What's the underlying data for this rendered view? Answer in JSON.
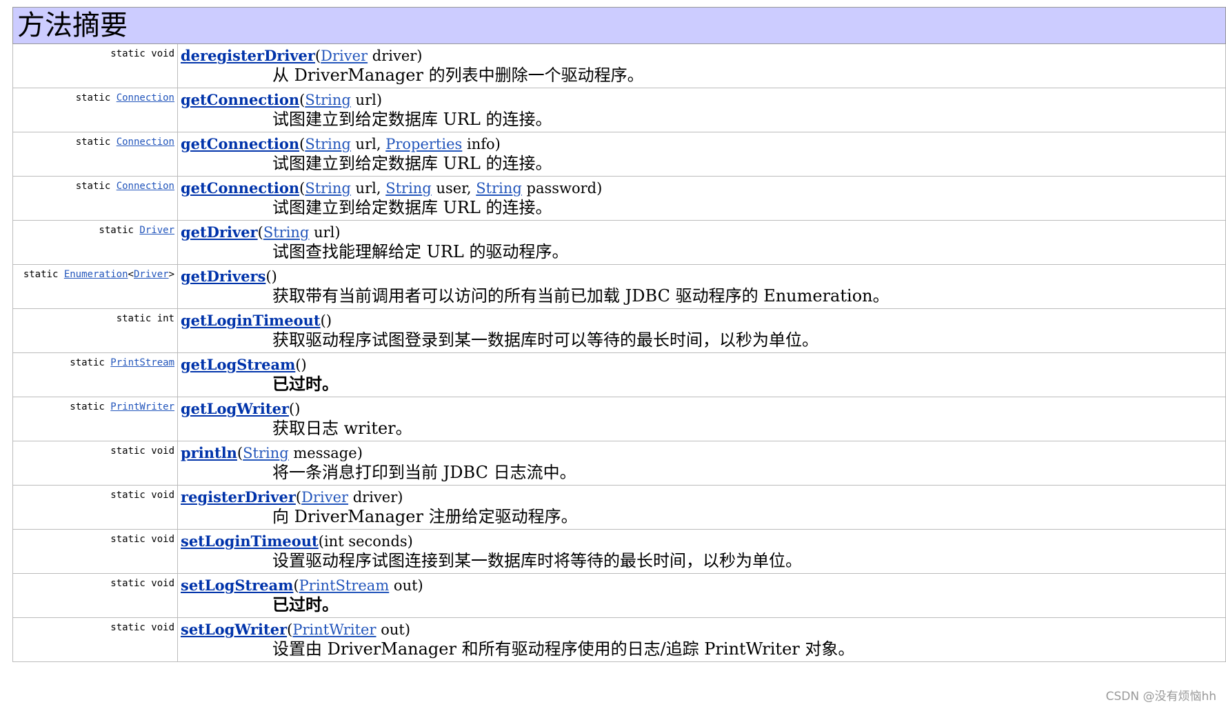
{
  "title": "方法摘要",
  "rows": [
    {
      "mod": "static void",
      "type": "",
      "name": "deregisterDriver",
      "params": [
        {
          "type": "Driver",
          "link": true,
          "name": "driver"
        }
      ],
      "desc": "从 DriverManager 的列表中删除一个驱动程序。",
      "bold": false
    },
    {
      "mod": "static",
      "type": "Connection",
      "name": "getConnection",
      "params": [
        {
          "type": "String",
          "link": true,
          "name": "url"
        }
      ],
      "desc": "试图建立到给定数据库 URL 的连接。",
      "bold": false
    },
    {
      "mod": "static",
      "type": "Connection",
      "name": "getConnection",
      "params": [
        {
          "type": "String",
          "link": true,
          "name": "url"
        },
        {
          "type": "Properties",
          "link": true,
          "name": "info"
        }
      ],
      "desc": "试图建立到给定数据库 URL 的连接。",
      "bold": false
    },
    {
      "mod": "static",
      "type": "Connection",
      "name": "getConnection",
      "params": [
        {
          "type": "String",
          "link": true,
          "name": "url"
        },
        {
          "type": "String",
          "link": true,
          "name": "user"
        },
        {
          "type": "String",
          "link": true,
          "name": "password"
        }
      ],
      "desc": "试图建立到给定数据库 URL 的连接。",
      "bold": false
    },
    {
      "mod": "static",
      "type": "Driver",
      "name": "getDriver",
      "params": [
        {
          "type": "String",
          "link": true,
          "name": "url"
        }
      ],
      "desc": "试图查找能理解给定 URL 的驱动程序。",
      "bold": false
    },
    {
      "mod": "static",
      "type": "Enumeration<Driver>",
      "name": "getDrivers",
      "params": [],
      "desc": "获取带有当前调用者可以访问的所有当前已加载 JDBC 驱动程序的 Enumeration。",
      "bold": false
    },
    {
      "mod": "static int",
      "type": "",
      "name": "getLoginTimeout",
      "params": [],
      "desc": "获取驱动程序试图登录到某一数据库时可以等待的最长时间，以秒为单位。",
      "bold": false
    },
    {
      "mod": "static",
      "type": "PrintStream",
      "name": "getLogStream",
      "params": [],
      "desc": "已过时。",
      "bold": true
    },
    {
      "mod": "static",
      "type": "PrintWriter",
      "name": "getLogWriter",
      "params": [],
      "desc": "获取日志 writer。",
      "bold": false
    },
    {
      "mod": "static void",
      "type": "",
      "name": "println",
      "params": [
        {
          "type": "String",
          "link": true,
          "name": "message"
        }
      ],
      "desc": "将一条消息打印到当前 JDBC 日志流中。",
      "bold": false
    },
    {
      "mod": "static void",
      "type": "",
      "name": "registerDriver",
      "params": [
        {
          "type": "Driver",
          "link": true,
          "name": "driver"
        }
      ],
      "desc": "向 DriverManager 注册给定驱动程序。",
      "bold": false
    },
    {
      "mod": "static void",
      "type": "",
      "name": "setLoginTimeout",
      "params": [
        {
          "type": "int",
          "link": false,
          "name": "seconds"
        }
      ],
      "desc": "设置驱动程序试图连接到某一数据库时将等待的最长时间，以秒为单位。",
      "bold": false
    },
    {
      "mod": "static void",
      "type": "",
      "name": "setLogStream",
      "params": [
        {
          "type": "PrintStream",
          "link": true,
          "name": "out"
        }
      ],
      "desc": "已过时。",
      "bold": true
    },
    {
      "mod": "static void",
      "type": "",
      "name": "setLogWriter",
      "params": [
        {
          "type": "PrintWriter",
          "link": true,
          "name": "out"
        }
      ],
      "desc": "设置由 DriverManager 和所有驱动程序使用的日志/追踪 PrintWriter 对象。",
      "bold": false
    }
  ],
  "watermark": "CSDN @没有烦恼hh"
}
